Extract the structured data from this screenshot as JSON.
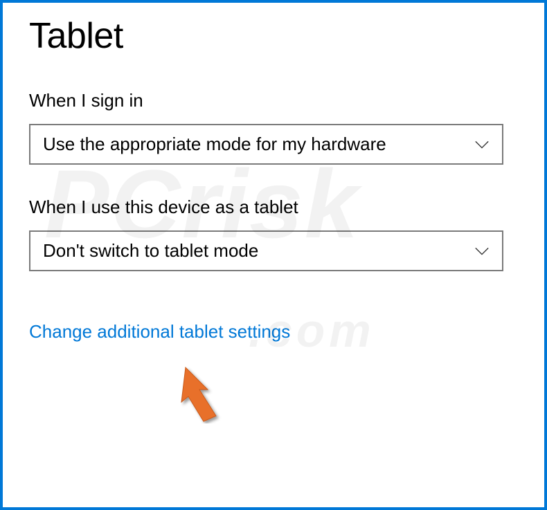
{
  "page": {
    "title": "Tablet"
  },
  "settings": {
    "signIn": {
      "label": "When I sign in",
      "value": "Use the appropriate mode for my hardware"
    },
    "deviceAsTablet": {
      "label": "When I use this device as a tablet",
      "value": "Don't switch to tablet mode"
    }
  },
  "link": {
    "label": "Change additional tablet settings"
  },
  "watermark": {
    "main": "PCrisk",
    "sub": ".com"
  }
}
